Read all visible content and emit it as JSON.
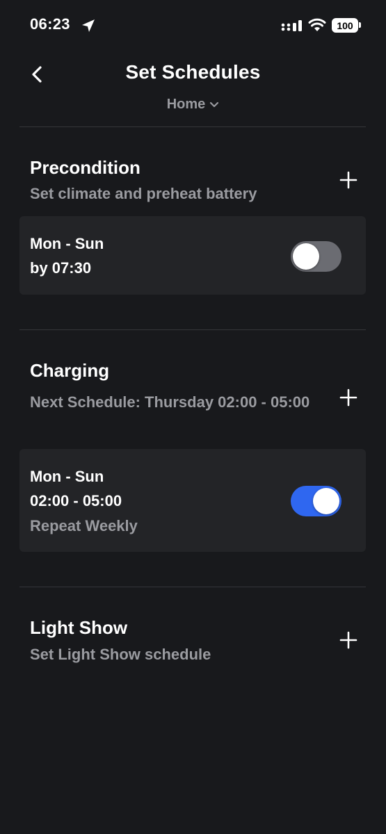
{
  "status_bar": {
    "time": "06:23",
    "battery": "100"
  },
  "header": {
    "title": "Set Schedules",
    "location": "Home"
  },
  "sections": {
    "precondition": {
      "title": "Precondition",
      "subtitle": "Set climate and preheat battery",
      "schedule": {
        "days": "Mon - Sun",
        "time": "by 07:30",
        "enabled": false
      }
    },
    "charging": {
      "title": "Charging",
      "subtitle": "Next Schedule: Thursday 02:00 - 05:00",
      "schedule": {
        "days": "Mon - Sun",
        "time": "02:00 - 05:00",
        "repeat": "Repeat Weekly",
        "enabled": true
      }
    },
    "light_show": {
      "title": "Light Show",
      "subtitle": "Set Light Show schedule"
    }
  },
  "colors": {
    "background": "#18191c",
    "card": "#232427",
    "muted_text": "#9a9ba0",
    "toggle_on": "#2f67f0",
    "toggle_off": "#6b6c72"
  }
}
